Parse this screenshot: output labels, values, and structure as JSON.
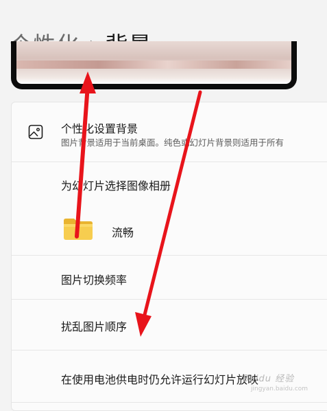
{
  "breadcrumb": {
    "parent": "个性化",
    "separator": "›",
    "current": "背景"
  },
  "background_setting": {
    "title": "个性化设置背景",
    "description": "图片背景适用于当前桌面。纯色或幻灯片背景则适用于所有"
  },
  "album": {
    "label": "为幻灯片选择图像相册",
    "folder_name": "流畅"
  },
  "interval": {
    "label": "图片切换频率"
  },
  "shuffle": {
    "label": "扰乱图片顺序"
  },
  "battery": {
    "label": "在使用电池供电时仍允许运行幻灯片放映"
  },
  "annotation_color": "#e8141b",
  "watermark": {
    "text": "Baidu 经验",
    "sub": "jingyan.baidu.com"
  }
}
